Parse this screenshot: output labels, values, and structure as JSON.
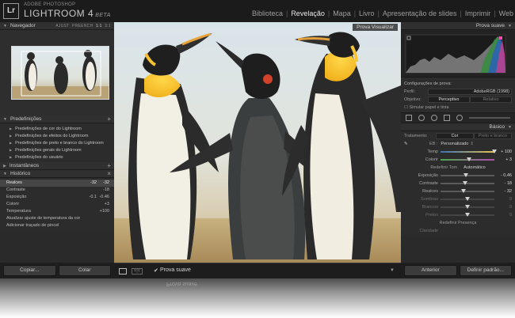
{
  "app": {
    "logo": "Lr",
    "brand_top": "ADOBE PHOTOSHOP",
    "brand_name": "LIGHTROOM 4",
    "brand_beta": "BETA"
  },
  "modules": [
    "Biblioteca",
    "Revelação",
    "Mapa",
    "Livro",
    "Apresentação de slides",
    "Imprimir",
    "Web"
  ],
  "active_module": "Revelação",
  "left": {
    "navigator": {
      "title": "Navegador",
      "zoom": [
        "AJUST",
        "PREENCH",
        "1:1",
        "3:1"
      ]
    },
    "presets": {
      "title": "Predefinições",
      "items": [
        "Predefinições de cor do Lightroom",
        "Predefinições de efeitos do Lightroom",
        "Predefinições de preto e branco do Lightroom",
        "Predefinições gerais do Lightroom",
        "Predefinições do usuário"
      ]
    },
    "snapshots": {
      "title": "Instantâneos"
    },
    "history": {
      "title": "Histórico",
      "items": [
        {
          "label": "Realces",
          "v1": "-32",
          "v2": "-32"
        },
        {
          "label": "Contraste",
          "v1": "",
          "v2": "-18"
        },
        {
          "label": "Exposição",
          "v1": "-0.1",
          "v2": "-0.46"
        },
        {
          "label": "Colorir",
          "v1": "",
          "v2": "+3"
        },
        {
          "label": "Temperatura",
          "v1": "",
          "v2": "+100"
        },
        {
          "label": "Atualizar ajuste de temperatura da cor",
          "v1": "",
          "v2": ""
        },
        {
          "label": "Adicionar traçado de pincel",
          "v1": "",
          "v2": ""
        }
      ]
    },
    "buttons": {
      "copy": "Copiar...",
      "paste": "Colar"
    }
  },
  "center": {
    "preview_tag": "Prova Visualizar",
    "soft_proof_check": "✔",
    "soft_proof_label": "Prova suave"
  },
  "right": {
    "title": "Prova suave",
    "proof_settings_title": "Configurações de prova:",
    "profile_label": "Perfil:",
    "profile_value": "AdobeRGB (1998)",
    "intent_label": "Objetivo:",
    "intent_on": "Perceptivo",
    "intent_off": "Relativo",
    "simulate": "Simular papel e tinta",
    "basic": {
      "title": "Básico",
      "treatment_label": "Tratamento:",
      "treatment_on": "Cor",
      "treatment_off": "Preto e branco",
      "wb_label": "EB :",
      "wb_value": "Personalizado",
      "temp_label": "Temp",
      "temp_value": "+ 100",
      "tint_label": "Colorir",
      "tint_value": "+ 3",
      "tone_label": "Redefinir Tom",
      "tone_auto": "Automático",
      "exposure_label": "Exposição",
      "exposure_value": "- 0,46",
      "contrast_label": "Contraste",
      "contrast_value": "- 18",
      "highlights_label": "Realces",
      "highlights_value": "- 32",
      "shadows_label": "Sombras",
      "shadows_value": "0",
      "whites_label": "Brancos",
      "whites_value": "0",
      "blacks_label": "Pretos",
      "blacks_value": "0",
      "presence_label": "Redefinir Presença",
      "clarity_label": "Claridade"
    },
    "buttons": {
      "previous": "Anterior",
      "reset": "Definir padrão..."
    }
  },
  "reflection_text": "Prova suave",
  "values": {
    "temp": 1.0,
    "tint": 0.53,
    "exposure": 0.47,
    "contrast": 0.45,
    "highlights": 0.42,
    "shadows": 0.5,
    "whites": 0.5,
    "blacks": 0.5
  }
}
